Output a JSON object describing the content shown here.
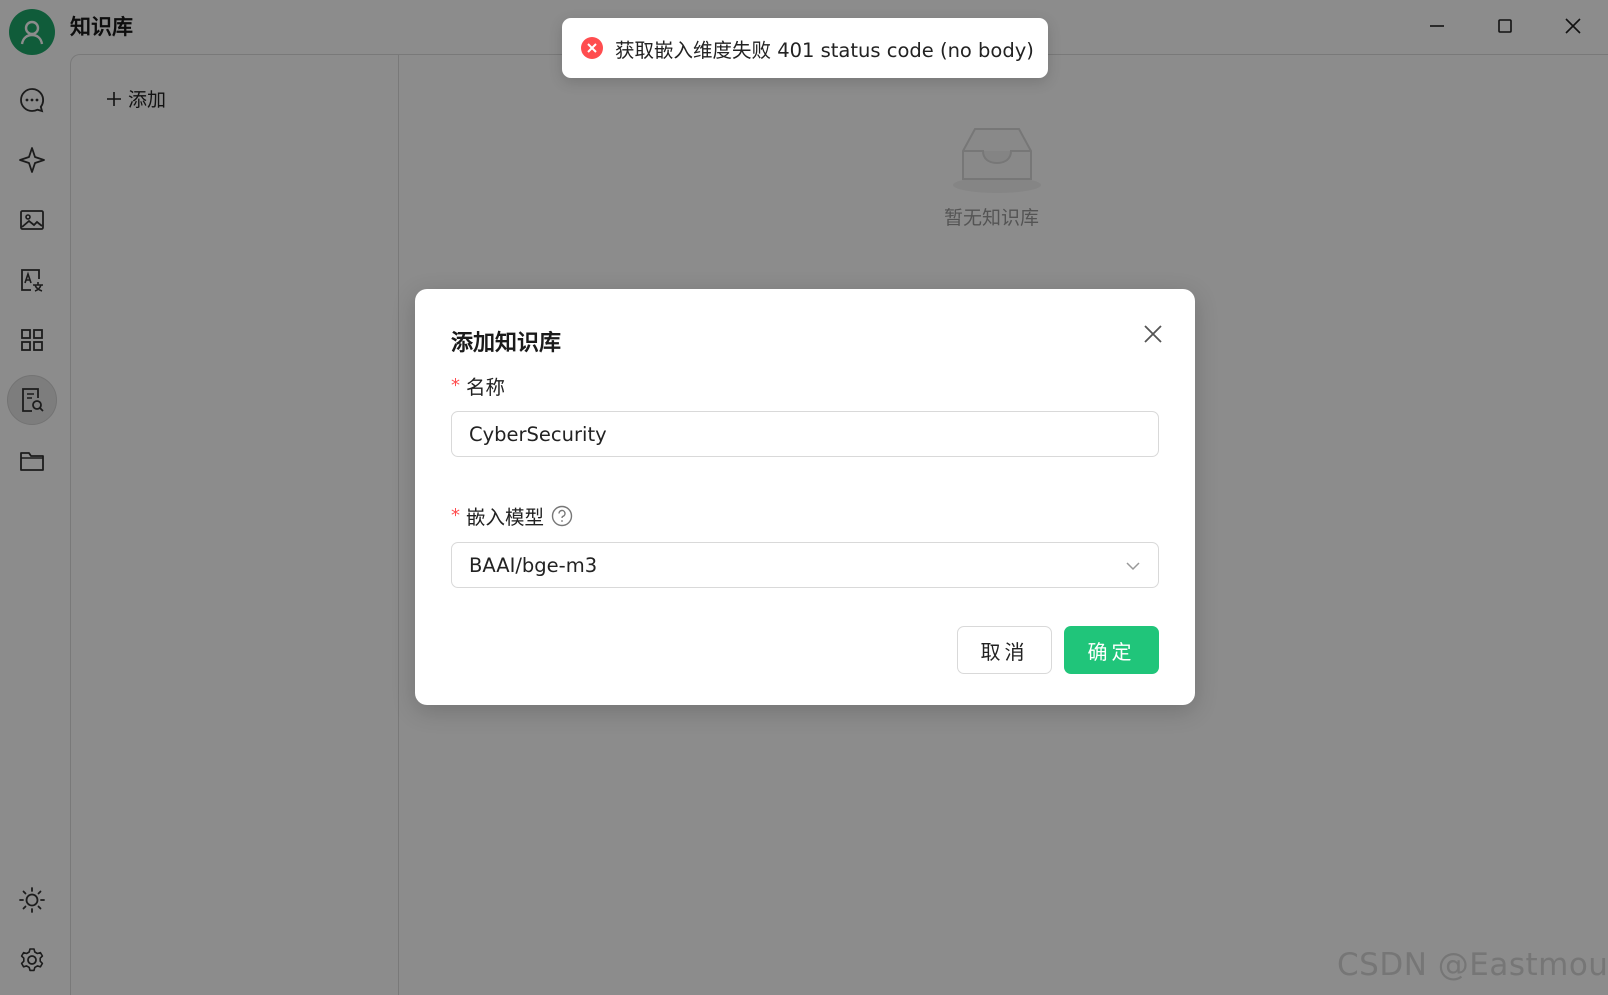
{
  "app": {
    "title": "知识库"
  },
  "sidebar": {
    "items": [
      {
        "icon": "chat-bubble-icon"
      },
      {
        "icon": "sparkle-icon"
      },
      {
        "icon": "image-icon"
      },
      {
        "icon": "translate-icon"
      },
      {
        "icon": "apps-grid-icon"
      },
      {
        "icon": "knowledge-search-icon",
        "active": true
      },
      {
        "icon": "folder-icon"
      }
    ],
    "bottom": [
      {
        "icon": "sun-icon"
      },
      {
        "icon": "settings-gear-icon"
      }
    ]
  },
  "left_panel": {
    "add_label": "添加"
  },
  "main": {
    "empty_text": "暂无知识库"
  },
  "toast": {
    "type": "error",
    "message": "获取嵌入维度失败 401 status code (no body)"
  },
  "modal": {
    "title": "添加知识库",
    "name_label": "名称",
    "name_value": "CyberSecurity",
    "model_label": "嵌入模型",
    "model_value": "BAAI/bge-m3",
    "cancel_label": "取消",
    "ok_label": "确定"
  },
  "watermark": "CSDN @Eastmount",
  "colors": {
    "brand": "#20c57a",
    "error": "#ff4d4f",
    "avatar": "#1ea86a"
  }
}
